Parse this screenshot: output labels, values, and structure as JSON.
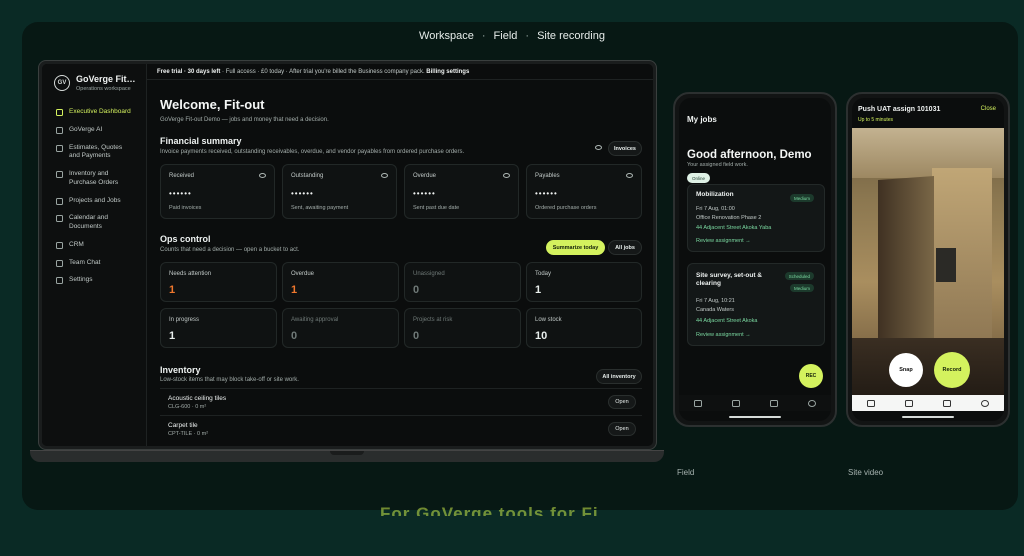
{
  "breadcrumbs": [
    "Workspace",
    "Field",
    "Site recording"
  ],
  "laptop": {
    "brand": {
      "logo": "GV",
      "name": "GoVerge Fit…",
      "sub": "Operations workspace"
    },
    "sidebar": [
      {
        "label": "Executive Dashboard",
        "active": true,
        "icon": "grid-icon"
      },
      {
        "label": "GoVerge AI",
        "icon": "sparkle-icon"
      },
      {
        "label": "Estimates, Quotes and Payments",
        "icon": "receipt-icon"
      },
      {
        "label": "Inventory and Purchase Orders",
        "icon": "box-icon"
      },
      {
        "label": "Projects and Jobs",
        "icon": "folder-icon"
      },
      {
        "label": "Calendar and Documents",
        "icon": "calendar-icon"
      },
      {
        "label": "CRM",
        "icon": "users-icon"
      },
      {
        "label": "Team Chat",
        "icon": "chat-icon"
      },
      {
        "label": "Settings",
        "icon": "gear-icon"
      }
    ],
    "banner": {
      "strong": "Free trial · 30 days left",
      "text": " · Full access · £0 today · After trial you're billed the Business company pack. ",
      "link": "Billing settings"
    },
    "welcome": "Welcome, Fit-out",
    "welcome_sub": "GoVerge Fit-out Demo — jobs and money that need a decision.",
    "financial": {
      "title": "Financial summary",
      "sub": "Invoice payments received, outstanding receivables, overdue, and vendor payables from ordered purchase orders.",
      "button": "Invoices",
      "cards": [
        {
          "label": "Received",
          "mask": "••••••",
          "note": "Paid invoices"
        },
        {
          "label": "Outstanding",
          "mask": "••••••",
          "note": "Sent, awaiting payment"
        },
        {
          "label": "Overdue",
          "mask": "••••••",
          "note": "Sent past due date"
        },
        {
          "label": "Payables",
          "mask": "••••••",
          "note": "Ordered purchase orders"
        }
      ]
    },
    "ops": {
      "title": "Ops control",
      "sub": "Counts that need a decision — open a bucket to act.",
      "summarize": "Summarize today",
      "all_jobs": "All jobs",
      "cards": [
        {
          "label": "Needs attention",
          "value": "1",
          "style": "orange"
        },
        {
          "label": "Overdue",
          "value": "1",
          "style": "orange"
        },
        {
          "label": "Unassigned",
          "value": "0",
          "style": "dim"
        },
        {
          "label": "Today",
          "value": "1",
          "style": ""
        },
        {
          "label": "In progress",
          "value": "1",
          "style": ""
        },
        {
          "label": "Awaiting approval",
          "value": "0",
          "style": "dim"
        },
        {
          "label": "Projects at risk",
          "value": "0",
          "style": "dim"
        },
        {
          "label": "Low stock",
          "value": "10",
          "style": ""
        }
      ]
    },
    "inventory": {
      "title": "Inventory",
      "sub": "Low-stock items that may block take-off or site work.",
      "button": "All inventory",
      "rows": [
        {
          "name": "Acoustic ceiling tiles",
          "detail": "CLG-600 · 0 m²",
          "action": "Open"
        },
        {
          "name": "Carpet tile",
          "detail": "CPT-TILE · 0 m²",
          "action": "Open"
        }
      ]
    }
  },
  "phone1": {
    "header": "My jobs",
    "greeting": "Good afternoon, Demo",
    "greeting_sub": "Your assigned field work.",
    "chip": "Online",
    "jobs": [
      {
        "title": "Mobilization",
        "badges": [
          "Medium"
        ],
        "date": "Fri 7 Aug, 01:00",
        "place": "Office Renovation Phase 2",
        "address": "44 Adjacent Street Akoka Yaba",
        "link": "Review assignment →"
      },
      {
        "title": "Site survey, set-out & clearing",
        "badges": [
          "Scheduled",
          "Medium"
        ],
        "date": "Fri 7 Aug, 10:21",
        "place": "Canada Waters",
        "address": "44 Adjacent Street Akoka",
        "link": "Review assignment →"
      }
    ],
    "fab": "REC",
    "label": "Field"
  },
  "phone2": {
    "title": "Push UAT assign 101031",
    "close": "Close",
    "limit": "Up to 5 minutes",
    "snap": "Snap",
    "record": "Record",
    "label": "Site video"
  },
  "bottom_text": "For GoVerge tools for Fi"
}
